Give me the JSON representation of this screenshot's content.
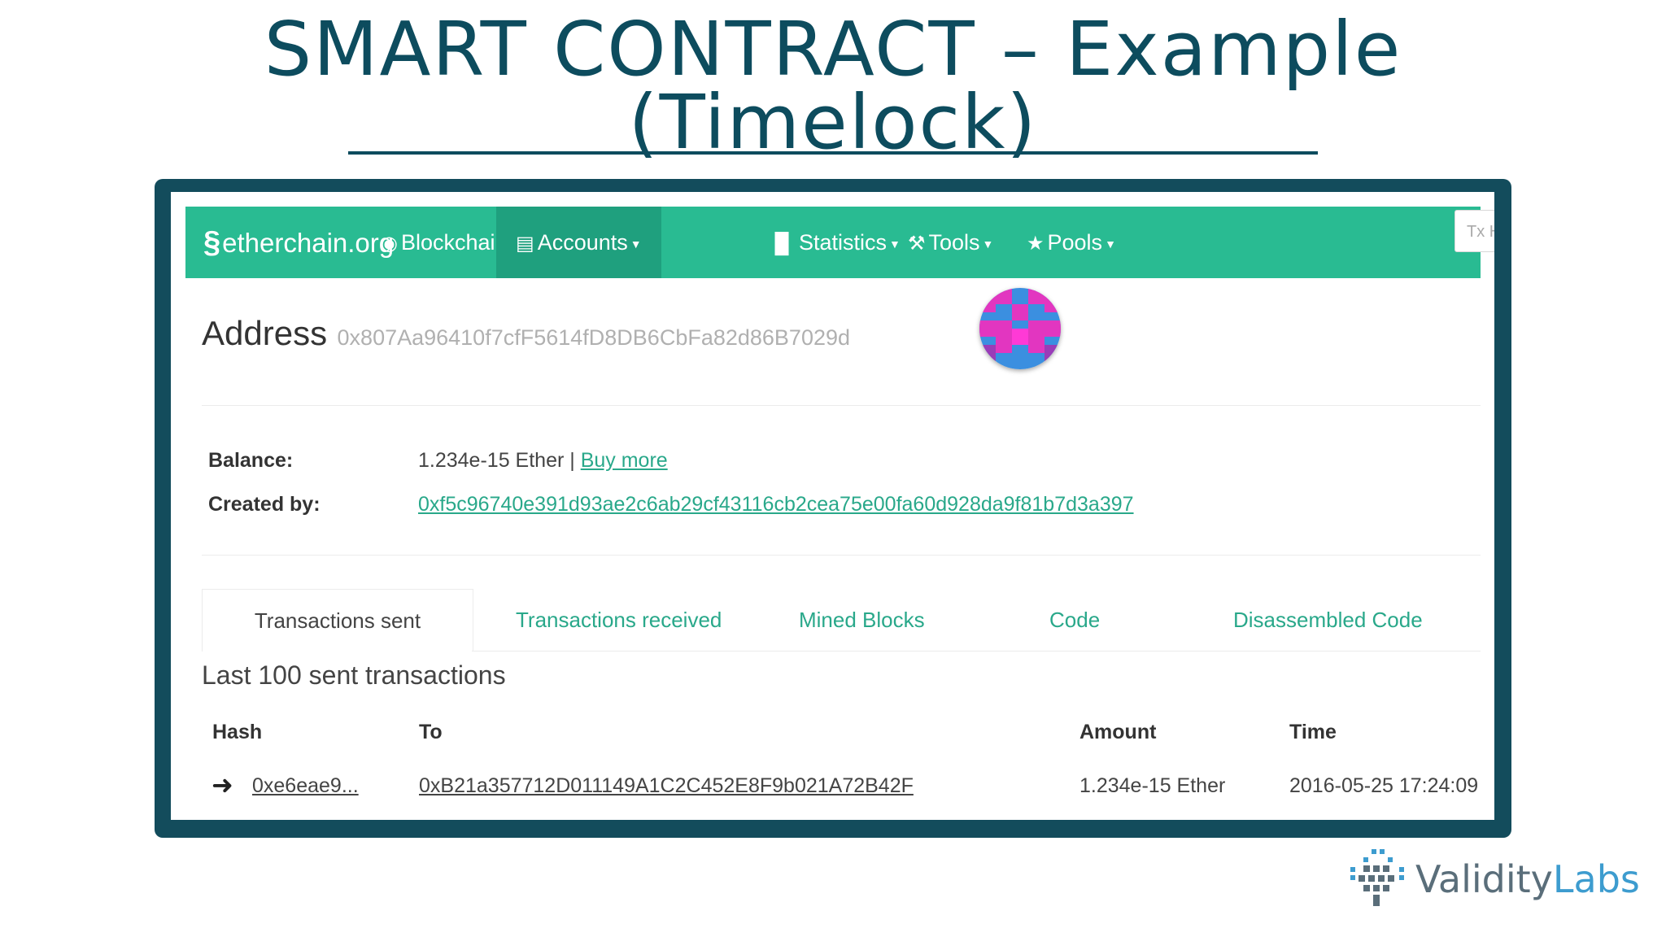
{
  "slide": {
    "title_line1": "SMART CONTRACT – Example",
    "title_line2": "(Timelock)"
  },
  "navbar": {
    "brand": "etherchain.org",
    "items": [
      {
        "label": "Blockchain",
        "icon": "eye-icon"
      },
      {
        "label": "Accounts",
        "icon": "list-icon"
      },
      {
        "label": "Statistics",
        "icon": "bar-chart-icon"
      },
      {
        "label": "Tools",
        "icon": "wrench-icon"
      },
      {
        "label": "Pools",
        "icon": "star-icon"
      }
    ],
    "search_placeholder": "Tx H"
  },
  "address": {
    "label": "Address",
    "value": "0x807Aa96410f7cfF5614fD8DB6CbFa82d86B7029d"
  },
  "details": {
    "balance_label": "Balance:",
    "balance_value": "1.234e-15 Ether |",
    "buy_more": "Buy more",
    "created_by_label": "Created by:",
    "created_by_value": "0xf5c96740e391d93ae2c6ab29cf43116cb2cea75e00fa60d928da9f81b7d3a397"
  },
  "tabs": [
    "Transactions sent",
    "Transactions received",
    "Mined Blocks",
    "Code",
    "Disassembled Code"
  ],
  "transactions": {
    "heading": "Last 100 sent transactions",
    "columns": [
      "Hash",
      "To",
      "Amount",
      "Time"
    ],
    "rows": [
      {
        "hash": "0xe6eae9...",
        "to": "0xB21a357712D011149A1C2C452E8F9b021A72B42F",
        "amount": "1.234e-15 Ether",
        "time": "2016-05-25 17:24:09"
      }
    ]
  },
  "footer": {
    "brand_part1": "Validity",
    "brand_part2": "Labs"
  },
  "colors": {
    "title": "#0d4c5e",
    "frame": "#134c5c",
    "navbar": "#29bb92",
    "link": "#29a88a"
  }
}
